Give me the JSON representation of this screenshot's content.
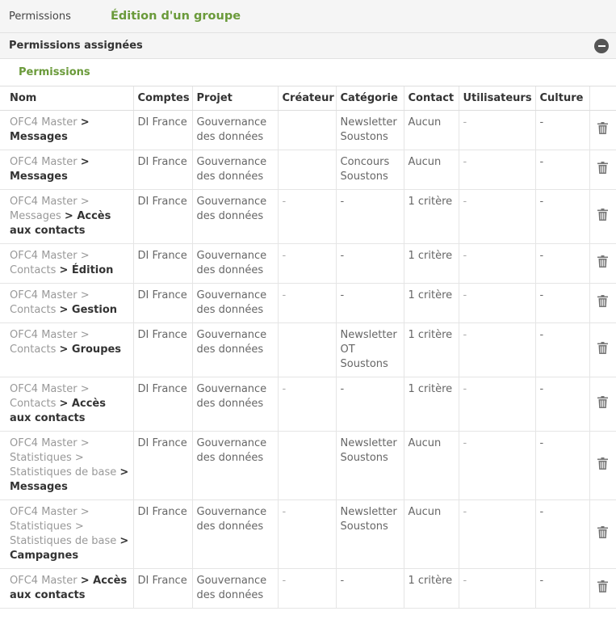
{
  "header": {
    "breadcrumb": "Permissions",
    "title": "Édition d'un groupe"
  },
  "section": {
    "label": "Permissions assignées"
  },
  "subsection": {
    "label": "Permissions"
  },
  "table": {
    "columns": [
      "Nom",
      "Comptes",
      "Projet",
      "Créateur",
      "Catégorie",
      "Contact",
      "Utilisateurs",
      "Culture"
    ],
    "rows": [
      {
        "path": [
          "OFC4 Master"
        ],
        "leaf": "Messages",
        "comptes": "DI France",
        "projet": "Gouvernance des données",
        "createur": "",
        "categorie": "Newsletter Soustons",
        "contact": "Aucun",
        "utilisateurs": "-",
        "culture": "-"
      },
      {
        "path": [
          "OFC4 Master"
        ],
        "leaf": "Messages",
        "comptes": "DI France",
        "projet": "Gouvernance des données",
        "createur": "",
        "categorie": "Concours Soustons",
        "contact": "Aucun",
        "utilisateurs": "-",
        "culture": "-"
      },
      {
        "path": [
          "OFC4 Master",
          "Messages"
        ],
        "leaf": "Accès aux contacts",
        "comptes": "DI France",
        "projet": "Gouvernance des données",
        "createur": "-",
        "categorie": "-",
        "contact": "1 critère",
        "utilisateurs": "-",
        "culture": "-"
      },
      {
        "path": [
          "OFC4 Master",
          "Contacts"
        ],
        "leaf": "Édition",
        "comptes": "DI France",
        "projet": "Gouvernance des données",
        "createur": "-",
        "categorie": "-",
        "contact": "1 critère",
        "utilisateurs": "-",
        "culture": "-"
      },
      {
        "path": [
          "OFC4 Master",
          "Contacts"
        ],
        "leaf": "Gestion",
        "comptes": "DI France",
        "projet": "Gouvernance des données",
        "createur": "-",
        "categorie": "-",
        "contact": "1 critère",
        "utilisateurs": "-",
        "culture": "-"
      },
      {
        "path": [
          "OFC4 Master",
          "Contacts"
        ],
        "leaf": "Groupes",
        "comptes": "DI France",
        "projet": "Gouvernance des données",
        "createur": "",
        "categorie": "Newsletter OT Soustons",
        "contact": "1 critère",
        "utilisateurs": "-",
        "culture": "-"
      },
      {
        "path": [
          "OFC4 Master",
          "Contacts"
        ],
        "leaf": "Accès aux contacts",
        "comptes": "DI France",
        "projet": "Gouvernance des données",
        "createur": "-",
        "categorie": "-",
        "contact": "1 critère",
        "utilisateurs": "-",
        "culture": "-"
      },
      {
        "path": [
          "OFC4 Master",
          "Statistiques",
          "Statistiques de base"
        ],
        "leaf": "Messages",
        "comptes": "DI France",
        "projet": "Gouvernance des données",
        "createur": "",
        "categorie": "Newsletter Soustons",
        "contact": "Aucun",
        "utilisateurs": "-",
        "culture": "-"
      },
      {
        "path": [
          "OFC4 Master",
          "Statistiques",
          "Statistiques de base"
        ],
        "leaf": "Campagnes",
        "comptes": "DI France",
        "projet": "Gouvernance des données",
        "createur": "-",
        "categorie": "Newsletter Soustons",
        "contact": "Aucun",
        "utilisateurs": "-",
        "culture": "-"
      },
      {
        "path": [
          "OFC4 Master"
        ],
        "leaf": "Accès aux contacts",
        "comptes": "DI France",
        "projet": "Gouvernance des données",
        "createur": "-",
        "categorie": "-",
        "contact": "1 critère",
        "utilisateurs": "-",
        "culture": "-"
      }
    ]
  },
  "icons": {
    "collapse": "minus-circle-icon",
    "delete": "trash-icon"
  },
  "colors": {
    "accent": "#6a9a3a",
    "header_bg": "#f5f5f5"
  }
}
